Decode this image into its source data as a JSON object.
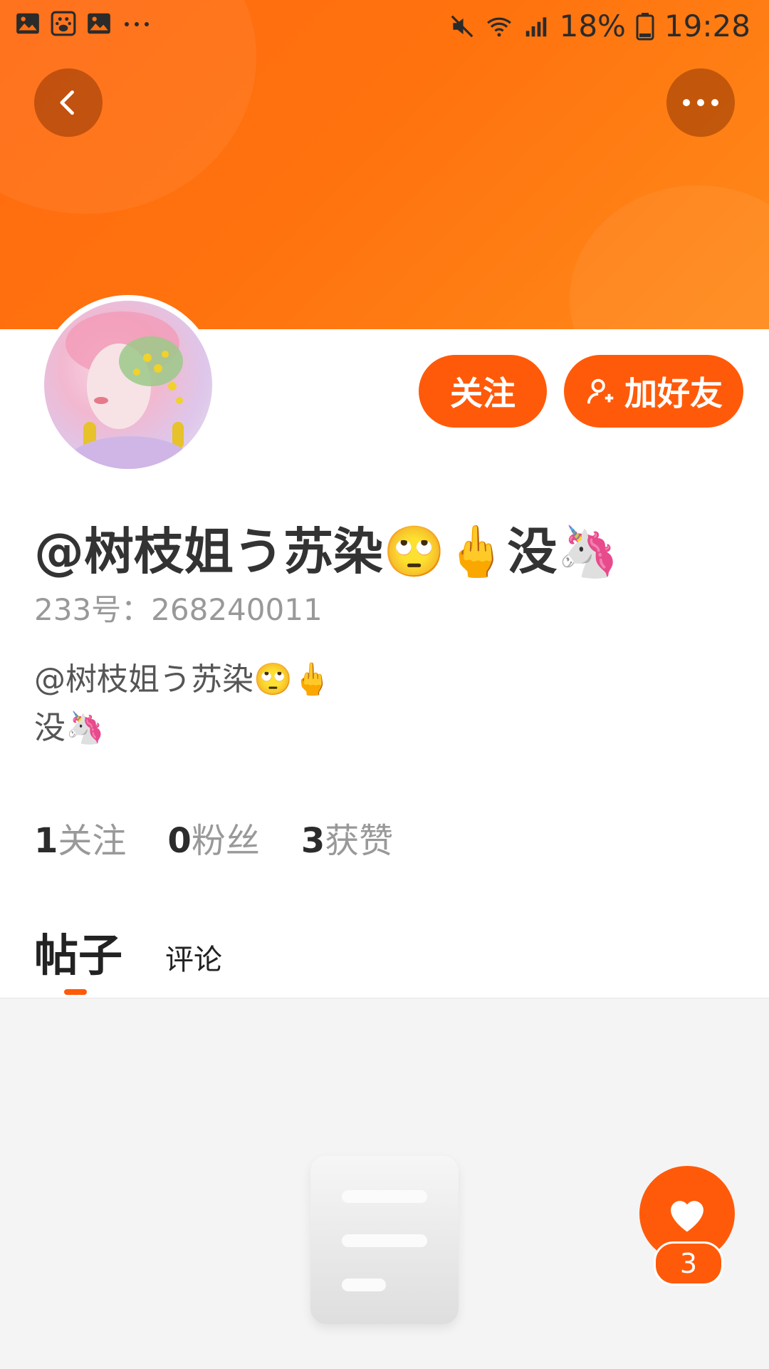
{
  "status_bar": {
    "battery": "18%",
    "time": "19:28"
  },
  "profile": {
    "name": "@树枝姐う苏染🙄🖕没🦄",
    "uid_line": "233号：268240011",
    "bio_line1": "@树枝姐う苏染🙄🖕",
    "bio_line2": "没🦄"
  },
  "actions": {
    "follow_label": "关注",
    "add_friend_label": "加好友"
  },
  "stats": [
    {
      "num": "1",
      "label": "关注"
    },
    {
      "num": "0",
      "label": "粉丝"
    },
    {
      "num": "3",
      "label": "获赞"
    }
  ],
  "tabs": [
    {
      "label": "帖子"
    },
    {
      "label": "评论"
    }
  ],
  "fab": {
    "count": "3"
  },
  "colors": {
    "accent": "#ff5a0a",
    "header": "#ff7010"
  }
}
